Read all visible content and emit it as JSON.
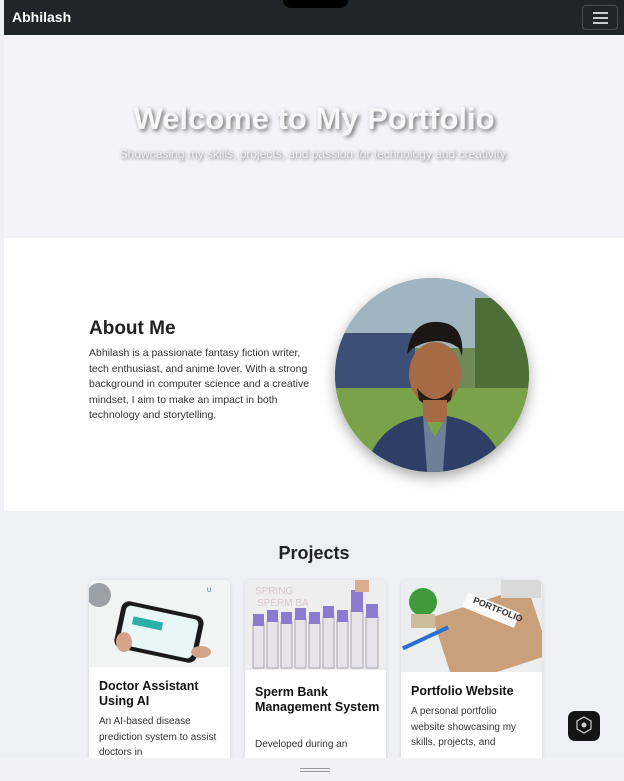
{
  "navbar": {
    "brand": "Abhilash",
    "menu_icon": "hamburger-icon"
  },
  "hero": {
    "title": "Welcome to My Portfolio",
    "subtitle": "Showcasing my skills, projects, and passion for technology and creativity."
  },
  "about": {
    "heading": "About Me",
    "text": "Abhilash is a passionate fantasy fiction writer, tech enthusiast, and anime lover. With a strong background in computer science and a creative mindset, I aim to make an impact in both technology and storytelling."
  },
  "projects": {
    "heading": "Projects",
    "cards": [
      {
        "title": "Doctor Assistant Using AI",
        "description": "An AI-based disease prediction system to assist doctors in"
      },
      {
        "title": "Sperm Bank Management System",
        "description": "Developed during an"
      },
      {
        "title": "Portfolio Website",
        "description": "A personal portfolio website showcasing my skills, projects, and"
      }
    ]
  },
  "colors": {
    "navbar": "#212529",
    "hero_bg": "#f4f4f8",
    "section_alt": "#eff0f4"
  }
}
